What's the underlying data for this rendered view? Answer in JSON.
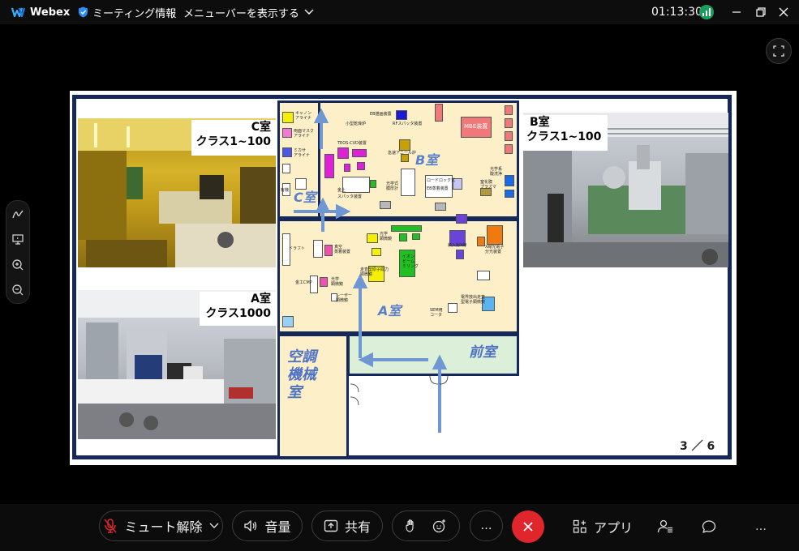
{
  "titlebar": {
    "app_name": "Webex",
    "meeting_info": "ミーティング情報",
    "show_menu": "メニューバーを表示する",
    "timer": "01:13:30"
  },
  "slide": {
    "c_room": {
      "name": "C室",
      "class": "クラス1~100"
    },
    "a_room": {
      "name": "A室",
      "class": "クラス1000"
    },
    "b_room": {
      "name": "B室",
      "class": "クラス1~100"
    },
    "page": "3 ／ 6",
    "plan": {
      "room_b": "B室",
      "room_c": "C室",
      "room_a": "A室",
      "anteroom": "前室",
      "hvac": "空調機械室",
      "tags": [
        {
          "text": "キャノン"
        },
        {
          "text": "アライナ"
        },
        {
          "text": "両面マスク"
        },
        {
          "text": "アライナ"
        },
        {
          "text": "ミカサ"
        },
        {
          "text": "アライナ"
        },
        {
          "text": "小型乾燥炉"
        },
        {
          "text": "EB描画装置"
        },
        {
          "text": "RFスパッタ装置"
        },
        {
          "text": "MBE装置"
        },
        {
          "text": "TEOS-CVD装置"
        },
        {
          "text": "急速アニール炉"
        },
        {
          "text": "光学系"
        },
        {
          "text": "酸洗浄"
        },
        {
          "text": "ロードロック式"
        },
        {
          "text": "EB蒸着装置"
        },
        {
          "text": "窒化膜"
        },
        {
          "text": "プラズマ"
        },
        {
          "text": "光学式"
        },
        {
          "text": "膜厚計"
        },
        {
          "text": "金上"
        },
        {
          "text": "スパッタ装置"
        },
        {
          "text": "有機"
        },
        {
          "text": "ドラフト"
        },
        {
          "text": "真空"
        },
        {
          "text": "蒸着装置"
        },
        {
          "text": "斜入射X線"
        },
        {
          "text": "X線光電子"
        },
        {
          "text": "分光装置"
        },
        {
          "text": "光学"
        },
        {
          "text": "顕微鏡"
        },
        {
          "text": "走査型原子間力"
        },
        {
          "text": "顕微鏡"
        },
        {
          "text": "イオン"
        },
        {
          "text": "ビーム"
        },
        {
          "text": "ミリング"
        },
        {
          "text": "金工CMP"
        },
        {
          "text": "光学"
        },
        {
          "text": "顕微鏡"
        },
        {
          "text": "レーザー"
        },
        {
          "text": "顕微鏡"
        },
        {
          "text": "電界放出走査"
        },
        {
          "text": "型電子顕微鏡"
        },
        {
          "text": "SEM用"
        },
        {
          "text": "コータ"
        }
      ]
    }
  },
  "toolbar": {
    "mute": "ミュート解除",
    "audio": "音量",
    "share": "共有",
    "apps": "アプリ",
    "more_left": "…",
    "more_right": "…"
  },
  "colors": {
    "end_call": "#e0252d",
    "slide_frame": "#14285a",
    "connection_good": "#1a9e5c"
  }
}
